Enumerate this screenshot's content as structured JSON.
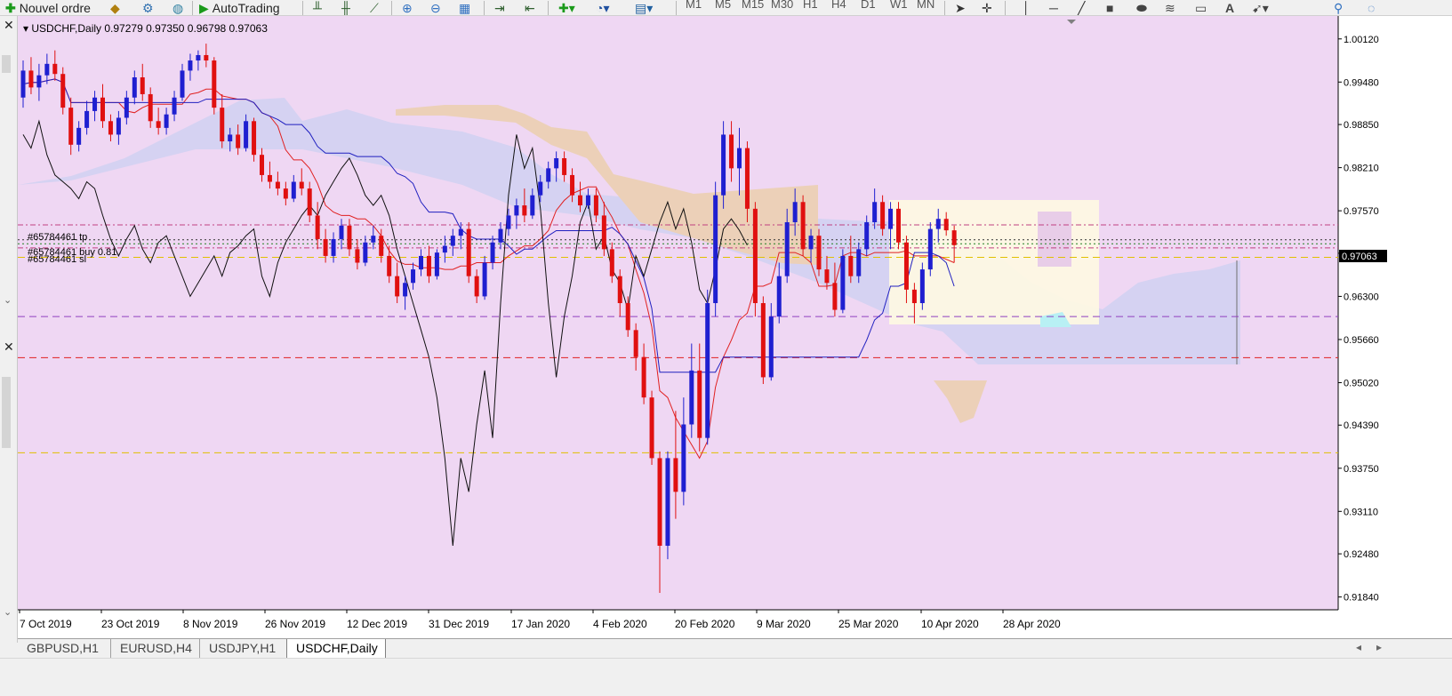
{
  "toolbar": {
    "new_order_label": "Nouvel ordre",
    "autotrading_label": "AutoTrading",
    "timeframes": [
      "M1",
      "M5",
      "M15",
      "M30",
      "H1",
      "H4",
      "D1",
      "W1",
      "MN"
    ]
  },
  "chart": {
    "header": "USDCHF,Daily  0.97279 0.97350 0.96798 0.97063",
    "current_price": "0.97063",
    "background_color": "#efd7f3",
    "bull_color": "#1f1fd0",
    "bear_color": "#e01010",
    "order_labels": {
      "tp": "#65784461 tp",
      "buy": "#65784461 buy 0.81",
      "sl": "#65784461 sl"
    }
  },
  "chart_data": {
    "type": "candlestick",
    "symbol": "USDCHF",
    "timeframe": "Daily",
    "ohlc_last": {
      "open": 0.97279,
      "high": 0.9735,
      "low": 0.96798,
      "close": 0.97063
    },
    "ylim": [
      0.9165,
      1.0046
    ],
    "price_ticks": [
      "1.00120",
      "0.99480",
      "0.98850",
      "0.98210",
      "0.97570",
      "0.96940",
      "0.96300",
      "0.95660",
      "0.95020",
      "0.94390",
      "0.93750",
      "0.93110",
      "0.92480",
      "0.91840"
    ],
    "price_tick_values": [
      1.0012,
      0.9948,
      0.9885,
      0.9821,
      0.9757,
      0.9694,
      0.963,
      0.9566,
      0.9502,
      0.9439,
      0.9375,
      0.9311,
      0.9248,
      0.9184
    ],
    "date_ticks": [
      "7 Oct 2019",
      "23 Oct 2019",
      "8 Nov 2019",
      "26 Nov 2019",
      "12 Dec 2019",
      "31 Dec 2019",
      "17 Jan 2020",
      "4 Feb 2020",
      "20 Feb 2020",
      "9 Mar 2020",
      "25 Mar 2020",
      "10 Apr 2020",
      "28 Apr 2020"
    ],
    "horizontal_lines": [
      {
        "price": 0.9736,
        "color": "#c04080",
        "style": "dash-dot",
        "label": "tp"
      },
      {
        "price": 0.9714,
        "color": "#303030",
        "style": "dot",
        "label": "buy"
      },
      {
        "price": 0.9708,
        "color": "#208020",
        "style": "dot"
      },
      {
        "price": 0.9702,
        "color": "#c04080",
        "style": "dash-dot",
        "label": "sl"
      },
      {
        "price": 0.9688,
        "color": "#e0c000",
        "style": "dash"
      },
      {
        "price": 0.96,
        "color": "#9040c0",
        "style": "dash"
      },
      {
        "price": 0.9539,
        "color": "#e02020",
        "style": "dash"
      },
      {
        "price": 0.9398,
        "color": "#e0c000",
        "style": "dash"
      }
    ],
    "candles": [
      {
        "o": 0.9925,
        "h": 0.998,
        "l": 0.991,
        "c": 0.9965
      },
      {
        "o": 0.9965,
        "h": 0.9985,
        "l": 0.993,
        "c": 0.994
      },
      {
        "o": 0.994,
        "h": 0.9975,
        "l": 0.992,
        "c": 0.9958
      },
      {
        "o": 0.9958,
        "h": 0.999,
        "l": 0.9945,
        "c": 0.9975
      },
      {
        "o": 0.9975,
        "h": 0.9995,
        "l": 0.995,
        "c": 0.996
      },
      {
        "o": 0.996,
        "h": 0.997,
        "l": 0.99,
        "c": 0.991
      },
      {
        "o": 0.991,
        "h": 0.9925,
        "l": 0.984,
        "c": 0.9855
      },
      {
        "o": 0.9855,
        "h": 0.989,
        "l": 0.9845,
        "c": 0.988
      },
      {
        "o": 0.988,
        "h": 0.992,
        "l": 0.987,
        "c": 0.9905
      },
      {
        "o": 0.9905,
        "h": 0.9935,
        "l": 0.989,
        "c": 0.9925
      },
      {
        "o": 0.9925,
        "h": 0.9945,
        "l": 0.988,
        "c": 0.989
      },
      {
        "o": 0.989,
        "h": 0.99,
        "l": 0.986,
        "c": 0.987
      },
      {
        "o": 0.987,
        "h": 0.9905,
        "l": 0.9855,
        "c": 0.9895
      },
      {
        "o": 0.9895,
        "h": 0.9935,
        "l": 0.9885,
        "c": 0.9925
      },
      {
        "o": 0.9925,
        "h": 0.9965,
        "l": 0.9915,
        "c": 0.9955
      },
      {
        "o": 0.9955,
        "h": 0.9975,
        "l": 0.992,
        "c": 0.993
      },
      {
        "o": 0.993,
        "h": 0.994,
        "l": 0.988,
        "c": 0.989
      },
      {
        "o": 0.989,
        "h": 0.991,
        "l": 0.987,
        "c": 0.988
      },
      {
        "o": 0.988,
        "h": 0.991,
        "l": 0.987,
        "c": 0.99
      },
      {
        "o": 0.99,
        "h": 0.9935,
        "l": 0.989,
        "c": 0.9925
      },
      {
        "o": 0.9925,
        "h": 0.9975,
        "l": 0.992,
        "c": 0.9965
      },
      {
        "o": 0.9965,
        "h": 0.999,
        "l": 0.995,
        "c": 0.998
      },
      {
        "o": 0.998,
        "h": 0.9995,
        "l": 0.9965,
        "c": 0.9988
      },
      {
        "o": 0.9988,
        "h": 1.0005,
        "l": 0.997,
        "c": 0.998
      },
      {
        "o": 0.998,
        "h": 0.9985,
        "l": 0.99,
        "c": 0.991
      },
      {
        "o": 0.991,
        "h": 0.993,
        "l": 0.985,
        "c": 0.986
      },
      {
        "o": 0.986,
        "h": 0.988,
        "l": 0.9845,
        "c": 0.987
      },
      {
        "o": 0.987,
        "h": 0.9885,
        "l": 0.984,
        "c": 0.985
      },
      {
        "o": 0.985,
        "h": 0.99,
        "l": 0.9845,
        "c": 0.989
      },
      {
        "o": 0.989,
        "h": 0.9895,
        "l": 0.983,
        "c": 0.984
      },
      {
        "o": 0.984,
        "h": 0.985,
        "l": 0.98,
        "c": 0.981
      },
      {
        "o": 0.981,
        "h": 0.983,
        "l": 0.979,
        "c": 0.98
      },
      {
        "o": 0.98,
        "h": 0.9815,
        "l": 0.978,
        "c": 0.979
      },
      {
        "o": 0.979,
        "h": 0.98,
        "l": 0.9765,
        "c": 0.9775
      },
      {
        "o": 0.9775,
        "h": 0.981,
        "l": 0.977,
        "c": 0.98
      },
      {
        "o": 0.98,
        "h": 0.982,
        "l": 0.978,
        "c": 0.979
      },
      {
        "o": 0.979,
        "h": 0.98,
        "l": 0.974,
        "c": 0.975
      },
      {
        "o": 0.975,
        "h": 0.977,
        "l": 0.97,
        "c": 0.9715
      },
      {
        "o": 0.9715,
        "h": 0.973,
        "l": 0.968,
        "c": 0.969
      },
      {
        "o": 0.969,
        "h": 0.9725,
        "l": 0.968,
        "c": 0.9715
      },
      {
        "o": 0.9715,
        "h": 0.9745,
        "l": 0.97,
        "c": 0.9735
      },
      {
        "o": 0.9735,
        "h": 0.9745,
        "l": 0.969,
        "c": 0.97
      },
      {
        "o": 0.97,
        "h": 0.9715,
        "l": 0.967,
        "c": 0.968
      },
      {
        "o": 0.968,
        "h": 0.972,
        "l": 0.9675,
        "c": 0.971
      },
      {
        "o": 0.971,
        "h": 0.9735,
        "l": 0.97,
        "c": 0.972
      },
      {
        "o": 0.972,
        "h": 0.973,
        "l": 0.968,
        "c": 0.969
      },
      {
        "o": 0.969,
        "h": 0.9705,
        "l": 0.965,
        "c": 0.966
      },
      {
        "o": 0.966,
        "h": 0.968,
        "l": 0.962,
        "c": 0.963
      },
      {
        "o": 0.963,
        "h": 0.966,
        "l": 0.961,
        "c": 0.965
      },
      {
        "o": 0.965,
        "h": 0.968,
        "l": 0.964,
        "c": 0.967
      },
      {
        "o": 0.967,
        "h": 0.97,
        "l": 0.966,
        "c": 0.969
      },
      {
        "o": 0.969,
        "h": 0.9705,
        "l": 0.965,
        "c": 0.966
      },
      {
        "o": 0.966,
        "h": 0.97,
        "l": 0.9655,
        "c": 0.9695
      },
      {
        "o": 0.9695,
        "h": 0.972,
        "l": 0.968,
        "c": 0.9705
      },
      {
        "o": 0.9705,
        "h": 0.973,
        "l": 0.969,
        "c": 0.972
      },
      {
        "o": 0.972,
        "h": 0.974,
        "l": 0.97,
        "c": 0.973
      },
      {
        "o": 0.973,
        "h": 0.974,
        "l": 0.965,
        "c": 0.966
      },
      {
        "o": 0.966,
        "h": 0.967,
        "l": 0.962,
        "c": 0.963
      },
      {
        "o": 0.963,
        "h": 0.969,
        "l": 0.9625,
        "c": 0.968
      },
      {
        "o": 0.968,
        "h": 0.972,
        "l": 0.967,
        "c": 0.971
      },
      {
        "o": 0.971,
        "h": 0.974,
        "l": 0.97,
        "c": 0.973
      },
      {
        "o": 0.973,
        "h": 0.976,
        "l": 0.972,
        "c": 0.975
      },
      {
        "o": 0.975,
        "h": 0.9775,
        "l": 0.973,
        "c": 0.9765
      },
      {
        "o": 0.9765,
        "h": 0.979,
        "l": 0.974,
        "c": 0.975
      },
      {
        "o": 0.975,
        "h": 0.979,
        "l": 0.9745,
        "c": 0.978
      },
      {
        "o": 0.978,
        "h": 0.981,
        "l": 0.977,
        "c": 0.98
      },
      {
        "o": 0.98,
        "h": 0.983,
        "l": 0.979,
        "c": 0.982
      },
      {
        "o": 0.982,
        "h": 0.9845,
        "l": 0.98,
        "c": 0.9835
      },
      {
        "o": 0.9835,
        "h": 0.9845,
        "l": 0.98,
        "c": 0.981
      },
      {
        "o": 0.981,
        "h": 0.982,
        "l": 0.977,
        "c": 0.978
      },
      {
        "o": 0.978,
        "h": 0.98,
        "l": 0.9755,
        "c": 0.9765
      },
      {
        "o": 0.9765,
        "h": 0.979,
        "l": 0.976,
        "c": 0.978
      },
      {
        "o": 0.978,
        "h": 0.979,
        "l": 0.974,
        "c": 0.975
      },
      {
        "o": 0.975,
        "h": 0.977,
        "l": 0.969,
        "c": 0.97
      },
      {
        "o": 0.97,
        "h": 0.971,
        "l": 0.965,
        "c": 0.966
      },
      {
        "o": 0.966,
        "h": 0.967,
        "l": 0.96,
        "c": 0.962
      },
      {
        "o": 0.962,
        "h": 0.963,
        "l": 0.957,
        "c": 0.958
      },
      {
        "o": 0.958,
        "h": 0.959,
        "l": 0.952,
        "c": 0.954
      },
      {
        "o": 0.954,
        "h": 0.956,
        "l": 0.947,
        "c": 0.948
      },
      {
        "o": 0.948,
        "h": 0.949,
        "l": 0.938,
        "c": 0.939
      },
      {
        "o": 0.939,
        "h": 0.94,
        "l": 0.919,
        "c": 0.926
      },
      {
        "o": 0.926,
        "h": 0.94,
        "l": 0.924,
        "c": 0.939
      },
      {
        "o": 0.939,
        "h": 0.946,
        "l": 0.93,
        "c": 0.934
      },
      {
        "o": 0.934,
        "h": 0.948,
        "l": 0.932,
        "c": 0.944
      },
      {
        "o": 0.944,
        "h": 0.956,
        "l": 0.942,
        "c": 0.952
      },
      {
        "o": 0.952,
        "h": 0.956,
        "l": 0.94,
        "c": 0.942
      },
      {
        "o": 0.942,
        "h": 0.964,
        "l": 0.941,
        "c": 0.962
      },
      {
        "o": 0.962,
        "h": 0.98,
        "l": 0.96,
        "c": 0.978
      },
      {
        "o": 0.978,
        "h": 0.989,
        "l": 0.976,
        "c": 0.987
      },
      {
        "o": 0.987,
        "h": 0.989,
        "l": 0.98,
        "c": 0.982
      },
      {
        "o": 0.982,
        "h": 0.988,
        "l": 0.978,
        "c": 0.985
      },
      {
        "o": 0.985,
        "h": 0.986,
        "l": 0.974,
        "c": 0.976
      },
      {
        "o": 0.976,
        "h": 0.977,
        "l": 0.96,
        "c": 0.962
      },
      {
        "o": 0.962,
        "h": 0.963,
        "l": 0.95,
        "c": 0.951
      },
      {
        "o": 0.951,
        "h": 0.962,
        "l": 0.9505,
        "c": 0.96
      },
      {
        "o": 0.96,
        "h": 0.968,
        "l": 0.959,
        "c": 0.966
      },
      {
        "o": 0.966,
        "h": 0.976,
        "l": 0.965,
        "c": 0.974
      },
      {
        "o": 0.974,
        "h": 0.979,
        "l": 0.972,
        "c": 0.977
      },
      {
        "o": 0.977,
        "h": 0.978,
        "l": 0.969,
        "c": 0.97
      },
      {
        "o": 0.97,
        "h": 0.973,
        "l": 0.968,
        "c": 0.972
      },
      {
        "o": 0.972,
        "h": 0.973,
        "l": 0.966,
        "c": 0.967
      },
      {
        "o": 0.967,
        "h": 0.969,
        "l": 0.964,
        "c": 0.965
      },
      {
        "o": 0.965,
        "h": 0.968,
        "l": 0.96,
        "c": 0.961
      },
      {
        "o": 0.961,
        "h": 0.97,
        "l": 0.9605,
        "c": 0.969
      },
      {
        "o": 0.969,
        "h": 0.972,
        "l": 0.965,
        "c": 0.966
      },
      {
        "o": 0.966,
        "h": 0.971,
        "l": 0.965,
        "c": 0.97
      },
      {
        "o": 0.97,
        "h": 0.975,
        "l": 0.969,
        "c": 0.974
      },
      {
        "o": 0.974,
        "h": 0.979,
        "l": 0.973,
        "c": 0.977
      },
      {
        "o": 0.977,
        "h": 0.978,
        "l": 0.972,
        "c": 0.973
      },
      {
        "o": 0.973,
        "h": 0.977,
        "l": 0.97,
        "c": 0.976
      },
      {
        "o": 0.976,
        "h": 0.977,
        "l": 0.97,
        "c": 0.971
      },
      {
        "o": 0.971,
        "h": 0.972,
        "l": 0.962,
        "c": 0.964
      },
      {
        "o": 0.964,
        "h": 0.965,
        "l": 0.959,
        "c": 0.962
      },
      {
        "o": 0.962,
        "h": 0.968,
        "l": 0.961,
        "c": 0.967
      },
      {
        "o": 0.967,
        "h": 0.974,
        "l": 0.966,
        "c": 0.973
      },
      {
        "o": 0.973,
        "h": 0.976,
        "l": 0.971,
        "c": 0.9745
      },
      {
        "o": 0.9745,
        "h": 0.9755,
        "l": 0.972,
        "c": 0.9728
      },
      {
        "o": 0.9728,
        "h": 0.9735,
        "l": 0.968,
        "c": 0.9706
      }
    ]
  },
  "tabs": [
    {
      "label": "GBPUSD,H1",
      "active": false
    },
    {
      "label": "EURUSD,H4",
      "active": false
    },
    {
      "label": "USDJPY,H1",
      "active": false
    },
    {
      "label": "USDCHF,Daily",
      "active": true
    }
  ]
}
